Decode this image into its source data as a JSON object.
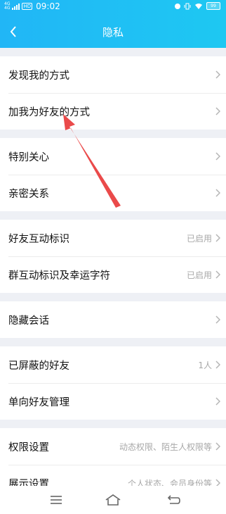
{
  "status_bar": {
    "network": "4G",
    "network_sub": "4G",
    "hd": "HD",
    "time": "09:02",
    "battery": "99"
  },
  "header": {
    "title": "隐私"
  },
  "sections": [
    {
      "items": [
        {
          "label": "发现我的方式",
          "value": ""
        },
        {
          "label": "加我为好友的方式",
          "value": ""
        }
      ]
    },
    {
      "items": [
        {
          "label": "特别关心",
          "value": ""
        },
        {
          "label": "亲密关系",
          "value": ""
        }
      ]
    },
    {
      "items": [
        {
          "label": "好友互动标识",
          "value": "已启用"
        },
        {
          "label": "群互动标识及幸运字符",
          "value": "已启用"
        }
      ]
    },
    {
      "items": [
        {
          "label": "隐藏会话",
          "value": ""
        }
      ]
    },
    {
      "items": [
        {
          "label": "已屏蔽的好友",
          "value": "1人"
        },
        {
          "label": "单向好友管理",
          "value": ""
        }
      ]
    },
    {
      "items": [
        {
          "label": "权限设置",
          "value": "动态权限、陌生人权限等"
        },
        {
          "label": "展示设置",
          "value": "个人状态、会员身份等"
        }
      ]
    }
  ],
  "colors": {
    "header": "#21b6f6",
    "annotation_arrow": "#ea4a4a"
  }
}
